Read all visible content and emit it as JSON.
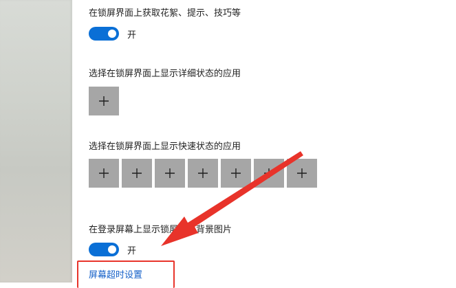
{
  "settings": {
    "fun_facts": {
      "label": "在锁屏界面上获取花絮、提示、技巧等",
      "state": "开"
    },
    "detailed_status": {
      "label": "选择在锁屏界面上显示详细状态的应用",
      "tile_symbol": "+"
    },
    "quick_status": {
      "label": "选择在锁屏界面上显示快速状态的应用",
      "tiles": [
        "+",
        "+",
        "+",
        "+",
        "+",
        "+",
        "+"
      ]
    },
    "signin_background": {
      "label": "在登录屏幕上显示锁屏界面背景图片",
      "state": "开"
    },
    "screen_timeout_link": "屏幕超时设置"
  },
  "colors": {
    "toggle_on": "#0a6fd6",
    "tile": "#a6a6a6",
    "link": "#1460c8",
    "annotation": "#e8332a"
  },
  "icons": {
    "add": "plus-icon",
    "annotation": "red-arrow"
  }
}
